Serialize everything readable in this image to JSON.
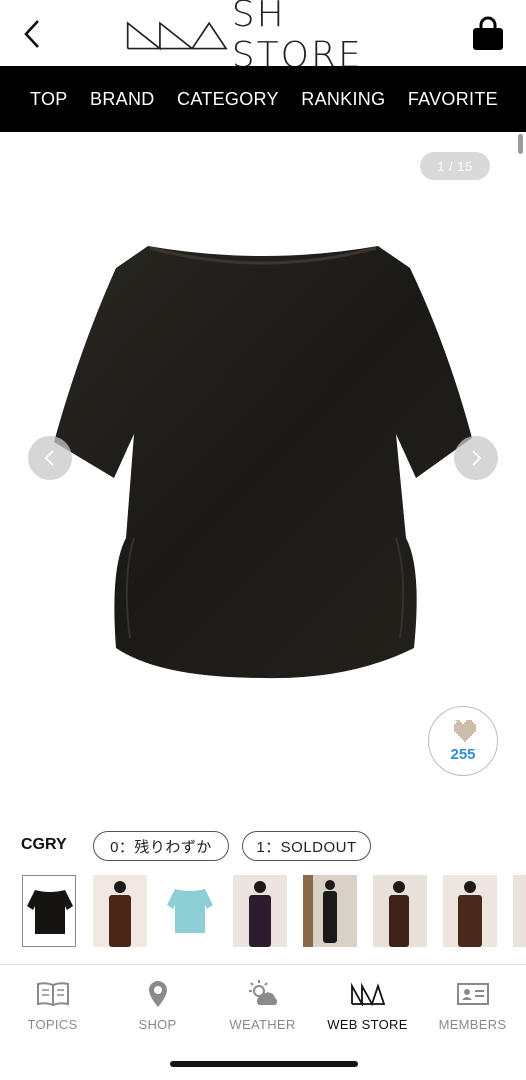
{
  "header": {
    "logo_text": "SH STORE",
    "logo_mark": "MA",
    "back_icon": "chevron-left-icon",
    "cart_icon": "shopping-bag-icon"
  },
  "nav": {
    "items": [
      {
        "label": "TOP"
      },
      {
        "label": "BRAND"
      },
      {
        "label": "CATEGORY"
      },
      {
        "label": "RANKING"
      },
      {
        "label": "FAVORITE"
      }
    ]
  },
  "gallery": {
    "page_indicator": "1 / 15",
    "current_page": 1,
    "total_pages": 15,
    "favorite_count": "255"
  },
  "variant": {
    "color_code": "CGRY",
    "stock": [
      {
        "label": "0：残りわずか"
      },
      {
        "label": "1：SOLDOUT"
      }
    ]
  },
  "thumbnails": [
    {
      "desc": "black top",
      "color": "#151412"
    },
    {
      "desc": "brown outfit",
      "color": "#4a2618"
    },
    {
      "desc": "light blue top",
      "color": "#8ecfd6"
    },
    {
      "desc": "purple outfit",
      "color": "#2d1b2e"
    },
    {
      "desc": "black dress",
      "color": "#1a1a1a"
    },
    {
      "desc": "brown dress",
      "color": "#3d2218"
    },
    {
      "desc": "brown set",
      "color": "#4a2a1c"
    }
  ],
  "tabbar": {
    "items": [
      {
        "label": "TOPICS",
        "icon": "book-icon"
      },
      {
        "label": "SHOP",
        "icon": "location-pin-icon"
      },
      {
        "label": "WEATHER",
        "icon": "weather-icon"
      },
      {
        "label": "WEB STORE",
        "icon": "store-logo-icon"
      },
      {
        "label": "MEMBERS",
        "icon": "member-card-icon"
      }
    ],
    "active": "WEB STORE"
  },
  "colors": {
    "nav_bg": "#000000",
    "favorite_count": "#2f8fd3",
    "page_pill": "#d9d9d9"
  }
}
